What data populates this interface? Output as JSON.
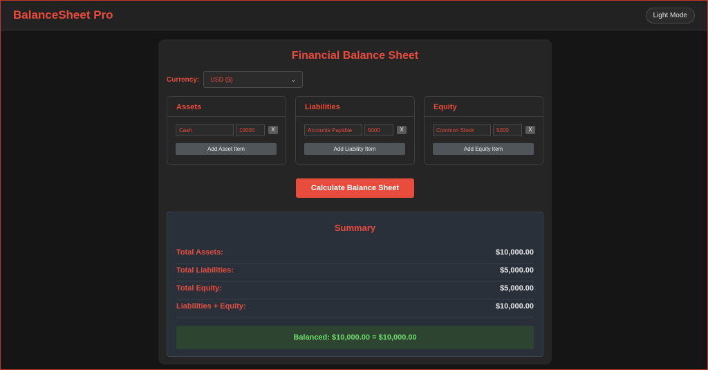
{
  "app": {
    "title": "BalanceSheet Pro",
    "mode_toggle": "Light Mode"
  },
  "page": {
    "title": "Financial Balance Sheet"
  },
  "currency": {
    "label": "Currency:",
    "selected": "USD ($)"
  },
  "sections": [
    {
      "key": "assets",
      "title": "Assets",
      "item_name": "Cash",
      "item_value": "10000",
      "remove_label": "X",
      "add_label": "Add Asset Item"
    },
    {
      "key": "liabilities",
      "title": "Liabilities",
      "item_name": "Accounts Payable",
      "item_value": "5000",
      "remove_label": "X",
      "add_label": "Add Liability Item"
    },
    {
      "key": "equity",
      "title": "Equity",
      "item_name": "Common Stock",
      "item_value": "5000",
      "remove_label": "X",
      "add_label": "Add Equity Item"
    }
  ],
  "calculate_label": "Calculate Balance Sheet",
  "summary": {
    "title": "Summary",
    "rows": [
      {
        "label": "Total Assets:",
        "value": "$10,000.00"
      },
      {
        "label": "Total Liabilities:",
        "value": "$5,000.00"
      },
      {
        "label": "Total Equity:",
        "value": "$5,000.00"
      },
      {
        "label": "Liabilities + Equity:",
        "value": "$10,000.00"
      }
    ],
    "status": "Balanced: $10,000.00 = $10,000.00"
  },
  "colors": {
    "accent": "#e74c3c",
    "balanced_text": "#6fdc6f",
    "balanced_bg": "#2c4430"
  },
  "icons": {
    "select_chevron": "chevron-down-icon"
  }
}
